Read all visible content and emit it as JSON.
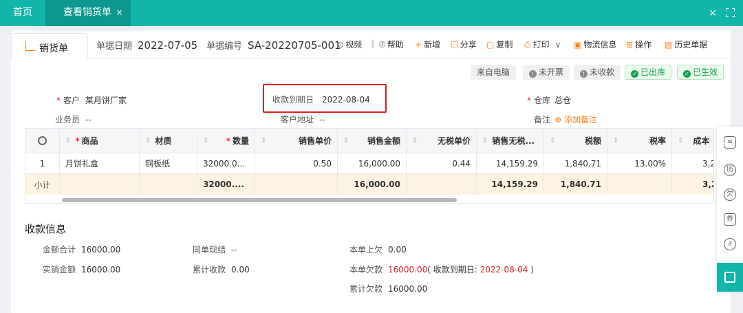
{
  "tabs": {
    "home": "首页",
    "active": "查看销货单",
    "close": "×"
  },
  "window": {
    "close": "×"
  },
  "doc": {
    "tab_label": "销货单",
    "date_label": "单据日期",
    "date_value": "2022-07-05",
    "no_label": "单据编号",
    "no_value": "SA-20220705-001"
  },
  "toolbar": {
    "video": "视频",
    "sep": "|",
    "help": "帮助",
    "add": "新增",
    "share": "分享",
    "copy": "复制",
    "print": "打印",
    "logistics": "物流信息",
    "operate": "操作",
    "history": "历史单据"
  },
  "badges": {
    "source": "来自电脑",
    "invoice": "未开票",
    "collect": "未收款",
    "out": "已出库",
    "effective": "已生效"
  },
  "form": {
    "customer_label": "客户",
    "customer_value": "某月饼厂家",
    "due_label": "收款到期日",
    "due_value": "2022-08-04",
    "warehouse_label": "仓库",
    "warehouse_value": "总仓",
    "sales_label": "业务员",
    "sales_value": "--",
    "addr_label": "客户地址",
    "addr_value": "--",
    "remark_label": "备注",
    "remark_add": "添加备注"
  },
  "table": {
    "headers": [
      "商品",
      "材质",
      "数量",
      "销售单价",
      "销售金额",
      "无税单价",
      "销售无税...",
      "税额",
      "税率",
      "成本"
    ],
    "row": [
      "1",
      "月饼礼盒",
      "铜板纸",
      "32000.0...",
      "0.50",
      "16,000.00",
      "0.44",
      "14,159.29",
      "1,840.71",
      "13.00%",
      "3,2"
    ],
    "sum": {
      "label": "小计",
      "qty": "32000....",
      "amount": "16,000.00",
      "notax": "14,159.29",
      "tax": "1,840.71",
      "cost": "3,2"
    }
  },
  "payment": {
    "title": "收款信息",
    "total_label": "金额合计",
    "total_value": "16000.00",
    "actual_label": "实销金额",
    "actual_value": "16000.00",
    "cash_label": "同单现结",
    "cash_value": "--",
    "cum_label": "累计收款",
    "cum_value": "0.00",
    "prev_label": "本单上欠",
    "prev_value": "0.00",
    "owe_label": "本单欠款",
    "owe_value": "16000.00",
    "owe_note_prefix": "( 收款到期日: ",
    "owe_note_date": "2022-08-04",
    "owe_note_suffix": " )",
    "cum_owe_label": "累计欠款",
    "cum_owe_value": "16000.00"
  },
  "sidebar": {
    "history": "历",
    "owe": "欠",
    "coupon": "券"
  },
  "colors": {
    "brand": "#12b5aa",
    "accent": "#ff7d1a",
    "danger": "#e02020",
    "success": "#16a34a"
  }
}
